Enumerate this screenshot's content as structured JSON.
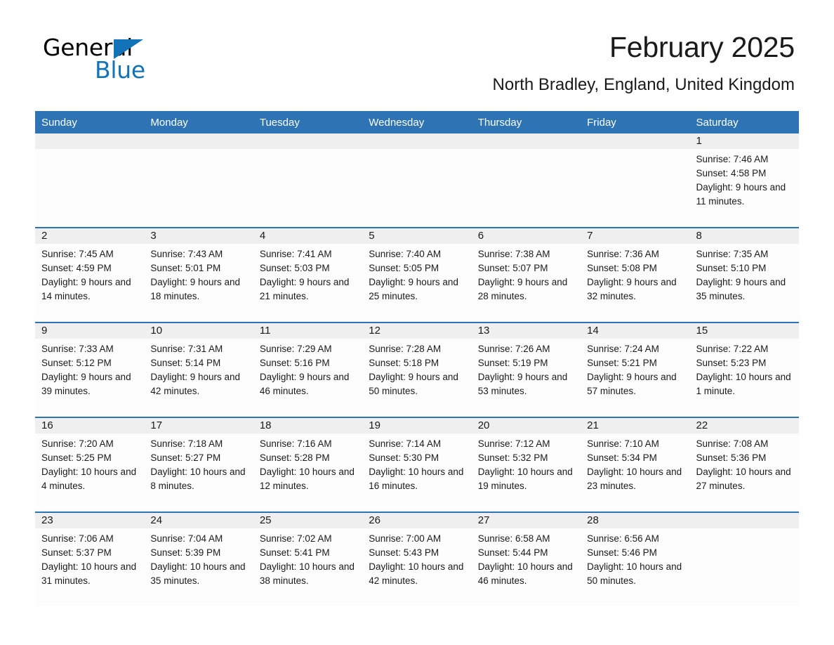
{
  "logo": {
    "text_primary": "General",
    "text_secondary": "Blue",
    "triangle_color": "#1273b8"
  },
  "header": {
    "title": "February 2025",
    "subtitle": "North Bradley, England, United Kingdom",
    "header_bg_color": "#2e74b5",
    "row_rule_color": "#2e74b5",
    "daynum_band_color": "#efefef"
  },
  "weekday_headers": [
    "Sunday",
    "Monday",
    "Tuesday",
    "Wednesday",
    "Thursday",
    "Friday",
    "Saturday"
  ],
  "labels": {
    "sunrise_prefix": "Sunrise: ",
    "sunset_prefix": "Sunset: ",
    "daylight_prefix": "Daylight: "
  },
  "weeks": [
    [
      {
        "day": "",
        "blank": true
      },
      {
        "day": "",
        "blank": true
      },
      {
        "day": "",
        "blank": true
      },
      {
        "day": "",
        "blank": true
      },
      {
        "day": "",
        "blank": true
      },
      {
        "day": "",
        "blank": true
      },
      {
        "day": "1",
        "sunrise": "Sunrise: 7:46 AM",
        "sunset": "Sunset: 4:58 PM",
        "daylight": "Daylight: 9 hours and 11 minutes."
      }
    ],
    [
      {
        "day": "2",
        "sunrise": "Sunrise: 7:45 AM",
        "sunset": "Sunset: 4:59 PM",
        "daylight": "Daylight: 9 hours and 14 minutes."
      },
      {
        "day": "3",
        "sunrise": "Sunrise: 7:43 AM",
        "sunset": "Sunset: 5:01 PM",
        "daylight": "Daylight: 9 hours and 18 minutes."
      },
      {
        "day": "4",
        "sunrise": "Sunrise: 7:41 AM",
        "sunset": "Sunset: 5:03 PM",
        "daylight": "Daylight: 9 hours and 21 minutes."
      },
      {
        "day": "5",
        "sunrise": "Sunrise: 7:40 AM",
        "sunset": "Sunset: 5:05 PM",
        "daylight": "Daylight: 9 hours and 25 minutes."
      },
      {
        "day": "6",
        "sunrise": "Sunrise: 7:38 AM",
        "sunset": "Sunset: 5:07 PM",
        "daylight": "Daylight: 9 hours and 28 minutes."
      },
      {
        "day": "7",
        "sunrise": "Sunrise: 7:36 AM",
        "sunset": "Sunset: 5:08 PM",
        "daylight": "Daylight: 9 hours and 32 minutes."
      },
      {
        "day": "8",
        "sunrise": "Sunrise: 7:35 AM",
        "sunset": "Sunset: 5:10 PM",
        "daylight": "Daylight: 9 hours and 35 minutes."
      }
    ],
    [
      {
        "day": "9",
        "sunrise": "Sunrise: 7:33 AM",
        "sunset": "Sunset: 5:12 PM",
        "daylight": "Daylight: 9 hours and 39 minutes."
      },
      {
        "day": "10",
        "sunrise": "Sunrise: 7:31 AM",
        "sunset": "Sunset: 5:14 PM",
        "daylight": "Daylight: 9 hours and 42 minutes."
      },
      {
        "day": "11",
        "sunrise": "Sunrise: 7:29 AM",
        "sunset": "Sunset: 5:16 PM",
        "daylight": "Daylight: 9 hours and 46 minutes."
      },
      {
        "day": "12",
        "sunrise": "Sunrise: 7:28 AM",
        "sunset": "Sunset: 5:18 PM",
        "daylight": "Daylight: 9 hours and 50 minutes."
      },
      {
        "day": "13",
        "sunrise": "Sunrise: 7:26 AM",
        "sunset": "Sunset: 5:19 PM",
        "daylight": "Daylight: 9 hours and 53 minutes."
      },
      {
        "day": "14",
        "sunrise": "Sunrise: 7:24 AM",
        "sunset": "Sunset: 5:21 PM",
        "daylight": "Daylight: 9 hours and 57 minutes."
      },
      {
        "day": "15",
        "sunrise": "Sunrise: 7:22 AM",
        "sunset": "Sunset: 5:23 PM",
        "daylight": "Daylight: 10 hours and 1 minute."
      }
    ],
    [
      {
        "day": "16",
        "sunrise": "Sunrise: 7:20 AM",
        "sunset": "Sunset: 5:25 PM",
        "daylight": "Daylight: 10 hours and 4 minutes."
      },
      {
        "day": "17",
        "sunrise": "Sunrise: 7:18 AM",
        "sunset": "Sunset: 5:27 PM",
        "daylight": "Daylight: 10 hours and 8 minutes."
      },
      {
        "day": "18",
        "sunrise": "Sunrise: 7:16 AM",
        "sunset": "Sunset: 5:28 PM",
        "daylight": "Daylight: 10 hours and 12 minutes."
      },
      {
        "day": "19",
        "sunrise": "Sunrise: 7:14 AM",
        "sunset": "Sunset: 5:30 PM",
        "daylight": "Daylight: 10 hours and 16 minutes."
      },
      {
        "day": "20",
        "sunrise": "Sunrise: 7:12 AM",
        "sunset": "Sunset: 5:32 PM",
        "daylight": "Daylight: 10 hours and 19 minutes."
      },
      {
        "day": "21",
        "sunrise": "Sunrise: 7:10 AM",
        "sunset": "Sunset: 5:34 PM",
        "daylight": "Daylight: 10 hours and 23 minutes."
      },
      {
        "day": "22",
        "sunrise": "Sunrise: 7:08 AM",
        "sunset": "Sunset: 5:36 PM",
        "daylight": "Daylight: 10 hours and 27 minutes."
      }
    ],
    [
      {
        "day": "23",
        "sunrise": "Sunrise: 7:06 AM",
        "sunset": "Sunset: 5:37 PM",
        "daylight": "Daylight: 10 hours and 31 minutes."
      },
      {
        "day": "24",
        "sunrise": "Sunrise: 7:04 AM",
        "sunset": "Sunset: 5:39 PM",
        "daylight": "Daylight: 10 hours and 35 minutes."
      },
      {
        "day": "25",
        "sunrise": "Sunrise: 7:02 AM",
        "sunset": "Sunset: 5:41 PM",
        "daylight": "Daylight: 10 hours and 38 minutes."
      },
      {
        "day": "26",
        "sunrise": "Sunrise: 7:00 AM",
        "sunset": "Sunset: 5:43 PM",
        "daylight": "Daylight: 10 hours and 42 minutes."
      },
      {
        "day": "27",
        "sunrise": "Sunrise: 6:58 AM",
        "sunset": "Sunset: 5:44 PM",
        "daylight": "Daylight: 10 hours and 46 minutes."
      },
      {
        "day": "28",
        "sunrise": "Sunrise: 6:56 AM",
        "sunset": "Sunset: 5:46 PM",
        "daylight": "Daylight: 10 hours and 50 minutes."
      },
      {
        "day": "",
        "blank": true
      }
    ]
  ]
}
